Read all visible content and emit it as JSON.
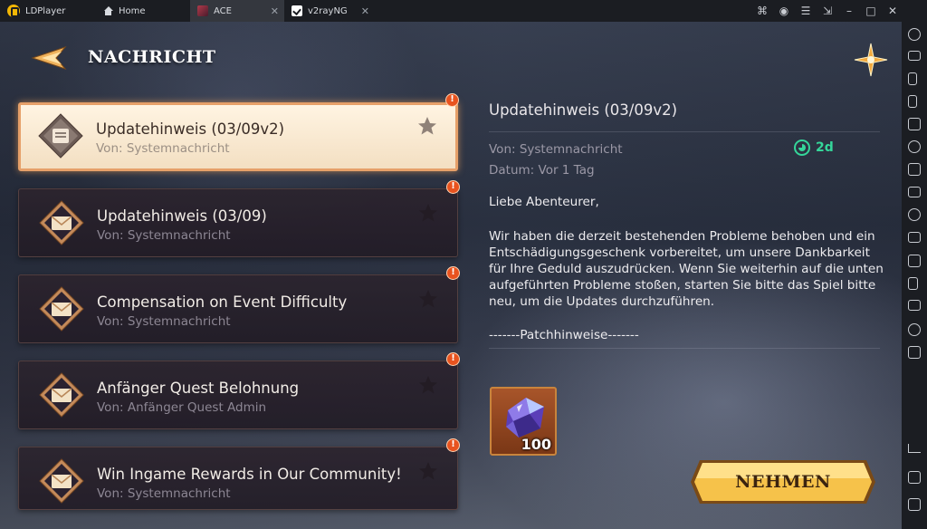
{
  "emulator": {
    "tabs": [
      {
        "label": "LDPlayer"
      },
      {
        "label": "Home"
      },
      {
        "label": "ACE"
      },
      {
        "label": "v2rayNG"
      }
    ]
  },
  "game": {
    "header": {
      "title": "NACHRICHT"
    },
    "mails": [
      {
        "title": "Updatehinweis (03/09v2)",
        "from": "Von: Systemnachricht",
        "alert": "!",
        "selected": true
      },
      {
        "title": "Updatehinweis (03/09)",
        "from": "Von: Systemnachricht",
        "alert": "!"
      },
      {
        "title": "Compensation on Event Difficulty",
        "from": "Von: Systemnachricht",
        "alert": "!"
      },
      {
        "title": "Anfänger Quest Belohnung",
        "from": "Von: Anfänger Quest Admin",
        "alert": "!"
      },
      {
        "title": "Win Ingame Rewards in Our Community!",
        "from": "Von: Systemnachricht",
        "alert": "!"
      }
    ],
    "detail": {
      "title": "Updatehinweis (03/09v2)",
      "from": "Von: Systemnachricht",
      "date": "Datum: Vor 1 Tag",
      "expires": "2d",
      "greeting": "Liebe Abenteurer,",
      "body_lines": [
        "Wir haben die derzeit bestehenden Probleme behoben und ein",
        "Entschädigungsgeschenk vorbereitet, um unsere Dankbarkeit",
        "für Ihre Geduld auszudrücken. Wenn Sie weiterhin auf die unten",
        "aufgeführten Probleme stoßen, starten Sie bitte das Spiel bitte",
        "neu, um die Updates durchzuführen."
      ],
      "patch_header": "-------Patchhinweise-------",
      "reward": {
        "item": "crystal-gem",
        "quantity": "100"
      },
      "take_button": "NEHMEN"
    }
  },
  "colors": {
    "accent": "#e6a069",
    "expire": "#35d69a",
    "alert": "#e8531f",
    "button": "#f6c24a"
  }
}
